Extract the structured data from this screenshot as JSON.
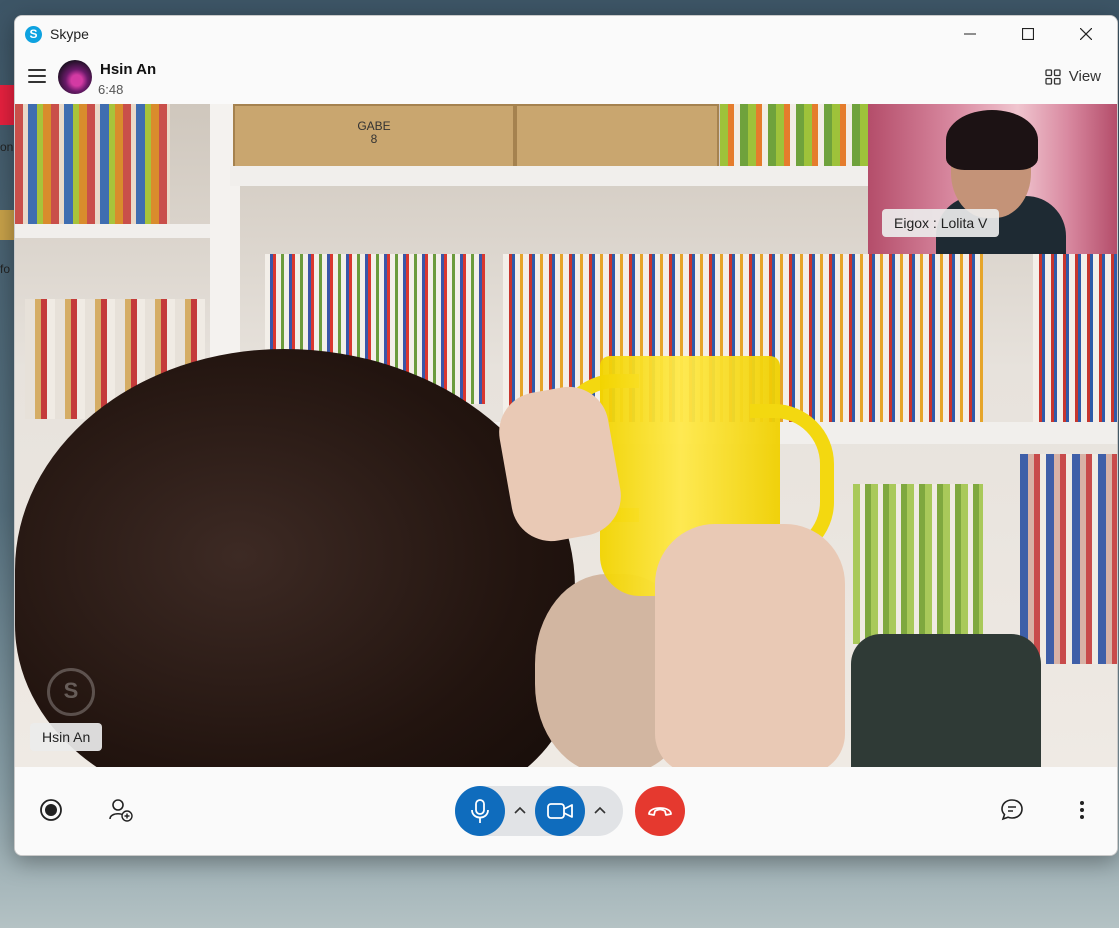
{
  "app": {
    "title": "Skype"
  },
  "window_controls": {
    "minimize": "—",
    "maximize": "☐",
    "close": "✕"
  },
  "header": {
    "contact_name": "Hsin An",
    "call_duration": "6:48",
    "view_label": "View"
  },
  "video": {
    "main_participant": "Hsin An",
    "remote_participant": "Eigox : Lolita V",
    "crate_label": "GABE\n8",
    "watermark": "S"
  },
  "controls": {
    "record_icon": "record-icon",
    "add_people_icon": "add-person-icon",
    "mic_icon": "microphone-icon",
    "camera_icon": "video-camera-icon",
    "hangup_icon": "hang-up-icon",
    "chat_icon": "chat-icon",
    "more_icon": "more-options-icon"
  },
  "colors": {
    "accent": "#0f6cbd",
    "hangup": "#e5392f",
    "skype_blue": "#0ea2e0"
  },
  "desktop": {
    "peek_texts": [
      "on",
      "fo"
    ]
  }
}
